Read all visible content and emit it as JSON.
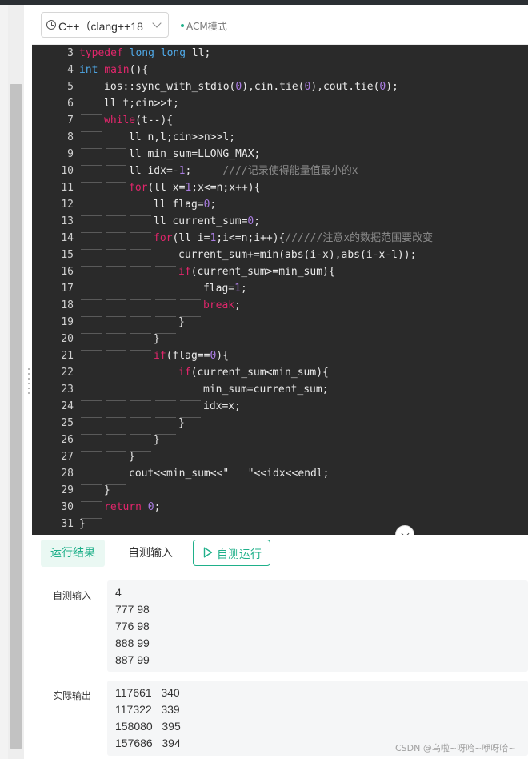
{
  "toolbar": {
    "language": "C++（clang++18",
    "mode": "ACM模式"
  },
  "editor": {
    "lines": [
      {
        "no": "3",
        "indent": 0,
        "tokens": [
          [
            "kw",
            "typedef"
          ],
          [
            "t",
            " "
          ],
          [
            "type",
            "long long"
          ],
          [
            "t",
            " ll;"
          ]
        ]
      },
      {
        "no": "4",
        "indent": 0,
        "tokens": [
          [
            "type",
            "int"
          ],
          [
            "t",
            " "
          ],
          [
            "kw",
            "main"
          ],
          [
            "t",
            "(){"
          ]
        ]
      },
      {
        "no": "5",
        "indent": 1,
        "tokens": [
          [
            "t",
            "ios::sync_with_stdio("
          ],
          [
            "num",
            "0"
          ],
          [
            "t",
            "),cin.tie("
          ],
          [
            "num",
            "0"
          ],
          [
            "t",
            "),cout.tie("
          ],
          [
            "num",
            "0"
          ],
          [
            "t",
            ");"
          ]
        ]
      },
      {
        "no": "6",
        "indent": 1,
        "tokens": [
          [
            "t",
            "ll t;cin>>t;"
          ]
        ]
      },
      {
        "no": "7",
        "indent": 1,
        "tokens": [
          [
            "kw",
            "while"
          ],
          [
            "t",
            "(t--){"
          ]
        ]
      },
      {
        "no": "8",
        "indent": 2,
        "tokens": [
          [
            "t",
            "ll n,l;cin>>n>>l;"
          ]
        ]
      },
      {
        "no": "9",
        "indent": 2,
        "tokens": [
          [
            "t",
            "ll min_sum=LLONG_MAX;"
          ]
        ]
      },
      {
        "no": "10",
        "indent": 2,
        "tokens": [
          [
            "t",
            "ll idx=-"
          ],
          [
            "num",
            "1"
          ],
          [
            "t",
            ";     "
          ],
          [
            "cm",
            "////记录使得能量值最小的x"
          ]
        ]
      },
      {
        "no": "11",
        "indent": 2,
        "tokens": [
          [
            "kw",
            "for"
          ],
          [
            "t",
            "(ll x="
          ],
          [
            "num",
            "1"
          ],
          [
            "t",
            ";x<=n;x++){"
          ]
        ]
      },
      {
        "no": "12",
        "indent": 3,
        "tokens": [
          [
            "t",
            "ll flag="
          ],
          [
            "num",
            "0"
          ],
          [
            "t",
            ";"
          ]
        ]
      },
      {
        "no": "13",
        "indent": 3,
        "tokens": [
          [
            "t",
            "ll current_sum="
          ],
          [
            "num",
            "0"
          ],
          [
            "t",
            ";"
          ]
        ]
      },
      {
        "no": "14",
        "indent": 3,
        "tokens": [
          [
            "kw",
            "for"
          ],
          [
            "t",
            "(ll i="
          ],
          [
            "num",
            "1"
          ],
          [
            "t",
            ";i<=n;i++){"
          ],
          [
            "cm",
            "//////注意x的数据范围要改变"
          ]
        ]
      },
      {
        "no": "15",
        "indent": 4,
        "tokens": [
          [
            "t",
            "current_sum+=min(abs(i-x),abs(i-x-l));"
          ]
        ]
      },
      {
        "no": "16",
        "indent": 4,
        "tokens": [
          [
            "kw",
            "if"
          ],
          [
            "t",
            "(current_sum>=min_sum){"
          ]
        ]
      },
      {
        "no": "17",
        "indent": 5,
        "tokens": [
          [
            "t",
            "flag="
          ],
          [
            "num",
            "1"
          ],
          [
            "t",
            ";"
          ]
        ]
      },
      {
        "no": "18",
        "indent": 5,
        "tokens": [
          [
            "kw",
            "break"
          ],
          [
            "t",
            ";"
          ]
        ]
      },
      {
        "no": "19",
        "indent": 4,
        "tokens": [
          [
            "t",
            "}"
          ]
        ]
      },
      {
        "no": "20",
        "indent": 3,
        "tokens": [
          [
            "t",
            "}"
          ]
        ]
      },
      {
        "no": "21",
        "indent": 3,
        "tokens": [
          [
            "kw",
            "if"
          ],
          [
            "t",
            "(flag=="
          ],
          [
            "num",
            "0"
          ],
          [
            "t",
            "){"
          ]
        ]
      },
      {
        "no": "22",
        "indent": 4,
        "tokens": [
          [
            "kw",
            "if"
          ],
          [
            "t",
            "(current_sum<min_sum){"
          ]
        ]
      },
      {
        "no": "23",
        "indent": 5,
        "tokens": [
          [
            "t",
            "min_sum=current_sum;"
          ]
        ]
      },
      {
        "no": "24",
        "indent": 5,
        "tokens": [
          [
            "t",
            "idx=x;"
          ]
        ]
      },
      {
        "no": "25",
        "indent": 4,
        "tokens": [
          [
            "t",
            "}"
          ]
        ]
      },
      {
        "no": "26",
        "indent": 3,
        "tokens": [
          [
            "t",
            "}"
          ]
        ]
      },
      {
        "no": "27",
        "indent": 2,
        "tokens": [
          [
            "t",
            "}"
          ]
        ]
      },
      {
        "no": "28",
        "indent": 2,
        "tokens": [
          [
            "t",
            "cout<<min_sum<<\"   \"<<idx<<endl;"
          ]
        ]
      },
      {
        "no": "29",
        "indent": 1,
        "tokens": [
          [
            "t",
            "}"
          ]
        ]
      },
      {
        "no": "30",
        "indent": 1,
        "tokens": [
          [
            "kw",
            "return"
          ],
          [
            "t",
            " "
          ],
          [
            "num",
            "0"
          ],
          [
            "t",
            ";"
          ]
        ]
      },
      {
        "no": "31",
        "indent": 0,
        "tokens": [
          [
            "t",
            "}"
          ]
        ]
      }
    ]
  },
  "result": {
    "tab_result": "运行结果",
    "tab_custom": "自测输入",
    "run_button": "自测运行",
    "input_label": "自测输入",
    "input_lines": [
      "4",
      "777 98",
      "776 98",
      "888 99",
      "887 99"
    ],
    "output_label": "实际输出",
    "output_lines": [
      "117661   340",
      "117322   339",
      "158080   395",
      "157686   394"
    ]
  },
  "watermark": "CSDN @乌啦~呀哈~咿呀哈~",
  "colors": {
    "accent": "#1fb08a",
    "editor_bg": "#2a2a2a",
    "keyword": "#e0266b",
    "type": "#4fa9e8",
    "number": "#a97ce0",
    "comment": "#8a8a8a"
  }
}
